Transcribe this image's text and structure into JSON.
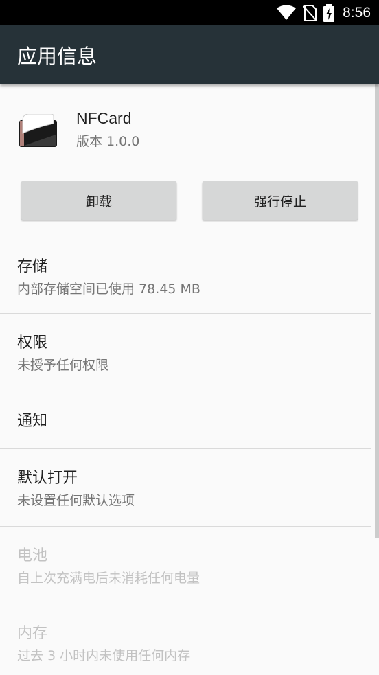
{
  "status_bar": {
    "time": "8:56",
    "icons": [
      "wifi-icon",
      "no-sim-icon",
      "battery-charging-icon"
    ]
  },
  "app_bar": {
    "title": "应用信息",
    "background": "#263238"
  },
  "app": {
    "name": "NFCard",
    "version": "版本 1.0.0",
    "icon": "nfcard-app-icon"
  },
  "buttons": {
    "uninstall": "卸载",
    "force_stop": "强行停止"
  },
  "preferences": [
    {
      "key": "storage",
      "title": "存储",
      "summary": "内部存储空间已使用 78.45 MB",
      "enabled": true
    },
    {
      "key": "permissions",
      "title": "权限",
      "summary": "未授予任何权限",
      "enabled": true
    },
    {
      "key": "notifications",
      "title": "通知",
      "summary": "",
      "enabled": true
    },
    {
      "key": "open-by-default",
      "title": "默认打开",
      "summary": "未设置任何默认选项",
      "enabled": true
    },
    {
      "key": "battery",
      "title": "电池",
      "summary": "自上次充满电后未消耗任何电量",
      "enabled": false
    },
    {
      "key": "memory",
      "title": "内存",
      "summary": "过去 3 小时内未使用任何内存",
      "enabled": false
    }
  ]
}
